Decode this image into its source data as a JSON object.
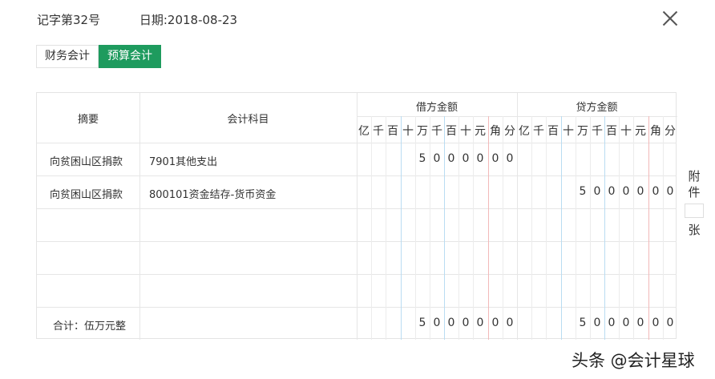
{
  "header": {
    "voucher_no": "记字第32号",
    "date_label": "日期:2018-08-23"
  },
  "tabs": [
    {
      "label": "财务会计",
      "active": false
    },
    {
      "label": "预算会计",
      "active": true
    }
  ],
  "table": {
    "col_summary": "摘要",
    "col_account": "会计科目",
    "col_debit": "借方金额",
    "col_credit": "贷方金额",
    "units": [
      "亿",
      "千",
      "百",
      "十",
      "万",
      "千",
      "百",
      "十",
      "元",
      "角",
      "分"
    ],
    "rows": [
      {
        "summary": "向贫困山区捐款",
        "account": "7901其他支出",
        "debit": [
          "",
          "",
          "",
          "",
          "5",
          "0",
          "0",
          "0",
          "0",
          "0",
          "0"
        ],
        "credit": [
          "",
          "",
          "",
          "",
          "",
          "",
          "",
          "",
          "",
          "",
          ""
        ]
      },
      {
        "summary": "向贫困山区捐款",
        "account": "800101资金结存-货币资金",
        "debit": [
          "",
          "",
          "",
          "",
          "",
          "",
          "",
          "",
          "",
          "",
          ""
        ],
        "credit": [
          "",
          "",
          "",
          "",
          "5",
          "0",
          "0",
          "0",
          "0",
          "0",
          "0"
        ]
      },
      {
        "summary": "",
        "account": "",
        "debit": [
          "",
          "",
          "",
          "",
          "",
          "",
          "",
          "",
          "",
          "",
          ""
        ],
        "credit": [
          "",
          "",
          "",
          "",
          "",
          "",
          "",
          "",
          "",
          "",
          ""
        ]
      },
      {
        "summary": "",
        "account": "",
        "debit": [
          "",
          "",
          "",
          "",
          "",
          "",
          "",
          "",
          "",
          "",
          ""
        ],
        "credit": [
          "",
          "",
          "",
          "",
          "",
          "",
          "",
          "",
          "",
          "",
          ""
        ]
      },
      {
        "summary": "",
        "account": "",
        "debit": [
          "",
          "",
          "",
          "",
          "",
          "",
          "",
          "",
          "",
          "",
          ""
        ],
        "credit": [
          "",
          "",
          "",
          "",
          "",
          "",
          "",
          "",
          "",
          "",
          ""
        ]
      }
    ],
    "total_label": "合计：伍万元整",
    "total_debit": [
      "",
      "",
      "",
      "",
      "5",
      "0",
      "0",
      "0",
      "0",
      "0",
      "0"
    ],
    "total_credit": [
      "",
      "",
      "",
      "",
      "5",
      "0",
      "0",
      "0",
      "0",
      "0",
      "0"
    ]
  },
  "attachment": {
    "label_top": "附件",
    "label_bottom": "张",
    "value": ""
  },
  "watermark": "头条 @会计星球",
  "colors": {
    "accent": "#1e9b5e",
    "grid_blue": "#b9dcf2",
    "grid_red": "#f2b9b9"
  }
}
